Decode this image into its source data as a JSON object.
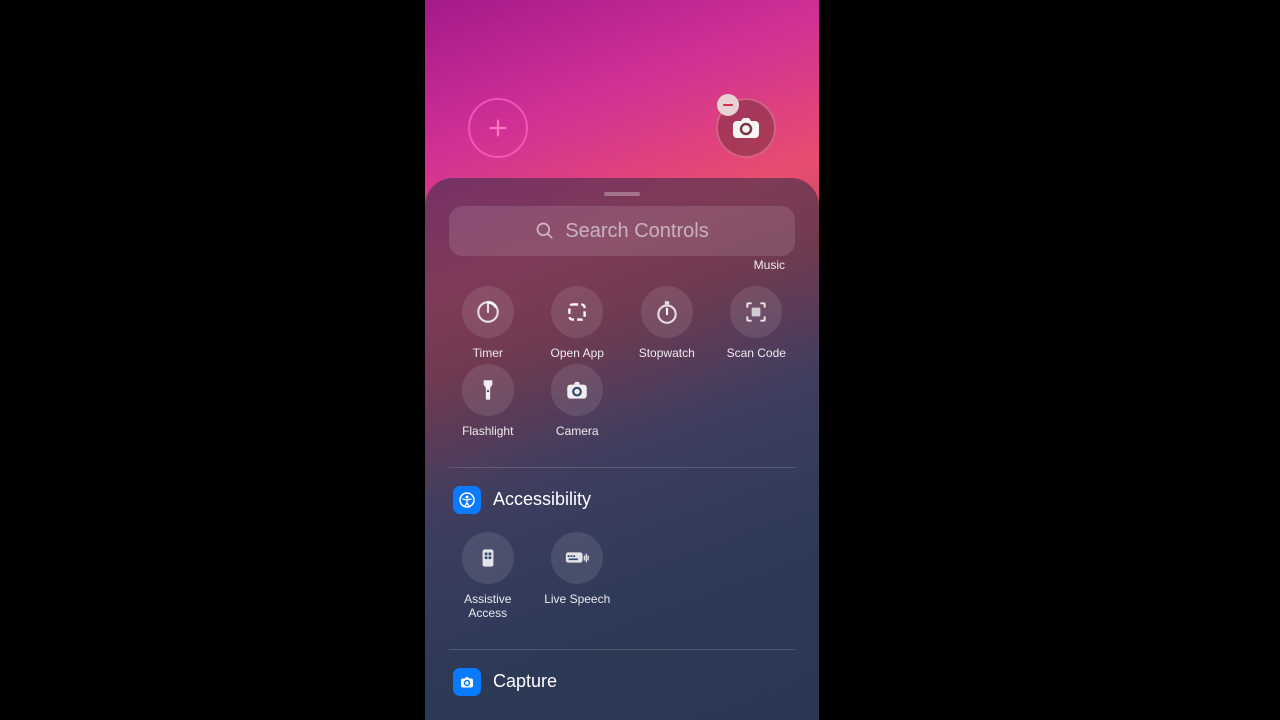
{
  "search": {
    "placeholder": "Search Controls"
  },
  "peek_label": "Music",
  "top_controls": [
    {
      "key": "timer",
      "label": "Timer"
    },
    {
      "key": "open-app",
      "label": "Open App"
    },
    {
      "key": "stopwatch",
      "label": "Stopwatch"
    },
    {
      "key": "scan-code",
      "label": "Scan Code"
    },
    {
      "key": "flashlight",
      "label": "Flashlight"
    },
    {
      "key": "camera",
      "label": "Camera"
    }
  ],
  "sections": [
    {
      "key": "accessibility",
      "title": "Accessibility",
      "items": [
        {
          "key": "assistive-access",
          "label": "Assistive Access"
        },
        {
          "key": "live-speech",
          "label": "Live Speech"
        }
      ]
    },
    {
      "key": "capture",
      "title": "Capture",
      "items": []
    }
  ]
}
